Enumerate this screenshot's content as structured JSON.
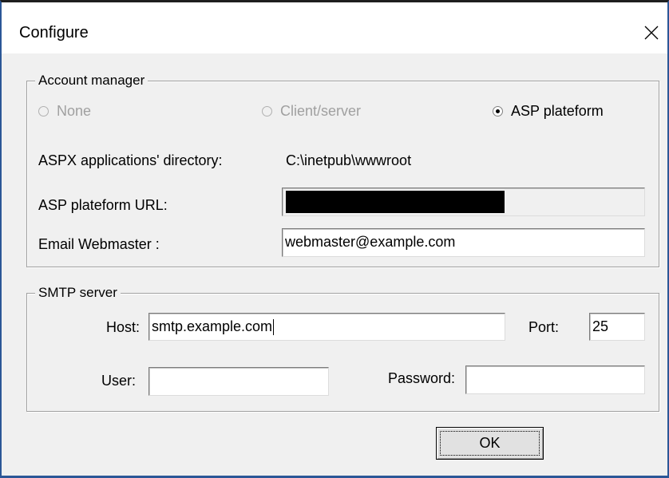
{
  "window": {
    "title": "Configure",
    "close_glyph": "close-icon"
  },
  "account_manager": {
    "group_label": "Account manager",
    "radios": [
      {
        "label": "None",
        "selected": false,
        "disabled": true
      },
      {
        "label": "Client/server",
        "selected": false,
        "disabled": true
      },
      {
        "label": "ASP plateform",
        "selected": true,
        "disabled": false
      }
    ],
    "aspx_dir_label": "ASPX applications' directory:",
    "aspx_dir_value": "C:\\inetpub\\wwwroot",
    "asp_url_label": "ASP plateform URL:",
    "email_label": "Email Webmaster :",
    "email_value": "webmaster@example.com"
  },
  "smtp": {
    "group_label": "SMTP server",
    "host_label": "Host:",
    "host_value": "smtp.example.com",
    "port_label": "Port:",
    "port_value": "25",
    "user_label": "User:",
    "user_value": "",
    "password_label": "Password:",
    "password_value": ""
  },
  "buttons": {
    "ok_label": "OK"
  }
}
